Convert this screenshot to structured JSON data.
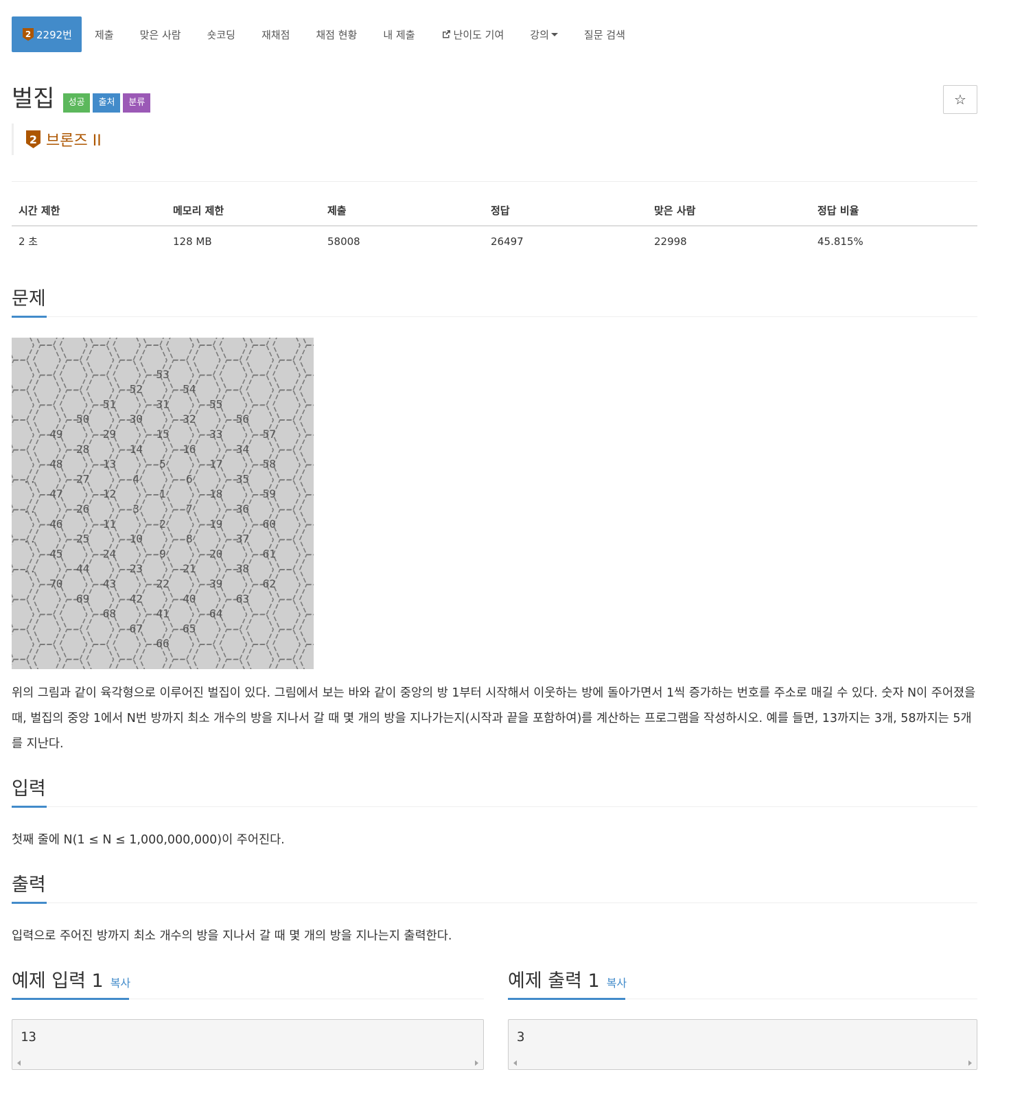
{
  "nav": {
    "items": [
      {
        "label": "2292번",
        "active": true,
        "tier_badge": "2"
      },
      {
        "label": "제출"
      },
      {
        "label": "맞은 사람"
      },
      {
        "label": "숏코딩"
      },
      {
        "label": "재채점"
      },
      {
        "label": "채점 현황"
      },
      {
        "label": "내 제출"
      },
      {
        "label": "난이도 기여",
        "icon": "external-link-icon"
      },
      {
        "label": "강의",
        "icon": "caret-down-icon"
      },
      {
        "label": "질문 검색"
      }
    ]
  },
  "problem": {
    "title": "벌집",
    "labels": [
      "성공",
      "출처",
      "분류"
    ],
    "tier_number": "2",
    "tier_label": "브론즈 II",
    "star_icon": "☆"
  },
  "stats": {
    "headers": [
      "시간 제한",
      "메모리 제한",
      "제출",
      "정답",
      "맞은 사람",
      "정답 비율"
    ],
    "values": [
      "2 초",
      "128 MB",
      "58008",
      "26497",
      "22998",
      "45.815%"
    ]
  },
  "sections": {
    "problem_title": "문제",
    "problem_text": "위의 그림과 같이 육각형으로 이루어진 벌집이 있다. 그림에서 보는 바와 같이 중앙의 방 1부터 시작해서 이웃하는 방에 돌아가면서 1씩 증가하는 번호를 주소로 매길 수 있다. 숫자 N이 주어졌을 때, 벌집의 중앙 1에서 N번 방까지 최소 개수의 방을 지나서 갈 때 몇 개의 방을 지나가는지(시작과 끝을 포함하여)를 계산하는 프로그램을 작성하시오. 예를 들면, 13까지는 3개, 58까지는 5개를 지난다.",
    "input_title": "입력",
    "input_text": "첫째 줄에 N(1 ≤ N ≤ 1,000,000,000)이 주어진다.",
    "output_title": "출력",
    "output_text": "입력으로 주어진 방까지 최소 개수의 방을 지나서 갈 때 몇 개의 방을 지나는지 출력한다."
  },
  "samples": {
    "input_title": "예제 입력 1",
    "output_title": "예제 출력 1",
    "copy_label": "복사",
    "input_value": "13",
    "output_value": "3"
  },
  "figure": {
    "cells": [
      {
        "n": "53",
        "c": 5,
        "r": 1
      },
      {
        "n": "52",
        "c": 4,
        "r": 2
      },
      {
        "n": "54",
        "c": 6,
        "r": 2
      },
      {
        "n": "51",
        "c": 3,
        "r": 3
      },
      {
        "n": "31",
        "c": 5,
        "r": 3
      },
      {
        "n": "55",
        "c": 7,
        "r": 3
      },
      {
        "n": "50",
        "c": 2,
        "r": 4
      },
      {
        "n": "30",
        "c": 4,
        "r": 4
      },
      {
        "n": "32",
        "c": 6,
        "r": 4
      },
      {
        "n": "56",
        "c": 8,
        "r": 4
      },
      {
        "n": "49",
        "c": 1,
        "r": 5
      },
      {
        "n": "29",
        "c": 3,
        "r": 5
      },
      {
        "n": "15",
        "c": 5,
        "r": 5
      },
      {
        "n": "33",
        "c": 7,
        "r": 5
      },
      {
        "n": "57",
        "c": 9,
        "r": 5
      },
      {
        "n": "28",
        "c": 2,
        "r": 6
      },
      {
        "n": "14",
        "c": 4,
        "r": 6
      },
      {
        "n": "16",
        "c": 6,
        "r": 6
      },
      {
        "n": "34",
        "c": 8,
        "r": 6
      },
      {
        "n": "48",
        "c": 1,
        "r": 7
      },
      {
        "n": "13",
        "c": 3,
        "r": 7
      },
      {
        "n": "5",
        "c": 5,
        "r": 7
      },
      {
        "n": "17",
        "c": 7,
        "r": 7
      },
      {
        "n": "58",
        "c": 9,
        "r": 7
      },
      {
        "n": "..",
        "c": 0,
        "r": 8
      },
      {
        "n": "27",
        "c": 2,
        "r": 8
      },
      {
        "n": "4",
        "c": 4,
        "r": 8
      },
      {
        "n": "6",
        "c": 6,
        "r": 8
      },
      {
        "n": "35",
        "c": 8,
        "r": 8
      },
      {
        "n": "47",
        "c": 1,
        "r": 9
      },
      {
        "n": "12",
        "c": 3,
        "r": 9
      },
      {
        "n": "1",
        "c": 5,
        "r": 9
      },
      {
        "n": "18",
        "c": 7,
        "r": 9
      },
      {
        "n": "59",
        "c": 9,
        "r": 9
      },
      {
        "n": "..",
        "c": 0,
        "r": 10
      },
      {
        "n": "26",
        "c": 2,
        "r": 10
      },
      {
        "n": "3",
        "c": 4,
        "r": 10
      },
      {
        "n": "7",
        "c": 6,
        "r": 10
      },
      {
        "n": "36",
        "c": 8,
        "r": 10
      },
      {
        "n": "46",
        "c": 1,
        "r": 11
      },
      {
        "n": "11",
        "c": 3,
        "r": 11
      },
      {
        "n": "2",
        "c": 5,
        "r": 11
      },
      {
        "n": "19",
        "c": 7,
        "r": 11
      },
      {
        "n": "60",
        "c": 9,
        "r": 11
      },
      {
        "n": "..",
        "c": 0,
        "r": 12
      },
      {
        "n": "25",
        "c": 2,
        "r": 12
      },
      {
        "n": "10",
        "c": 4,
        "r": 12
      },
      {
        "n": "8",
        "c": 6,
        "r": 12
      },
      {
        "n": "37",
        "c": 8,
        "r": 12
      },
      {
        "n": "45",
        "c": 1,
        "r": 13
      },
      {
        "n": "24",
        "c": 3,
        "r": 13
      },
      {
        "n": "9",
        "c": 5,
        "r": 13
      },
      {
        "n": "20",
        "c": 7,
        "r": 13
      },
      {
        "n": "61",
        "c": 9,
        "r": 13
      },
      {
        "n": "..",
        "c": 0,
        "r": 14
      },
      {
        "n": "44",
        "c": 2,
        "r": 14
      },
      {
        "n": "23",
        "c": 4,
        "r": 14
      },
      {
        "n": "21",
        "c": 6,
        "r": 14
      },
      {
        "n": "38",
        "c": 8,
        "r": 14
      },
      {
        "n": "70",
        "c": 1,
        "r": 15
      },
      {
        "n": "43",
        "c": 3,
        "r": 15
      },
      {
        "n": "22",
        "c": 5,
        "r": 15
      },
      {
        "n": "39",
        "c": 7,
        "r": 15
      },
      {
        "n": "62",
        "c": 9,
        "r": 15
      },
      {
        "n": "69",
        "c": 2,
        "r": 16
      },
      {
        "n": "42",
        "c": 4,
        "r": 16
      },
      {
        "n": "40",
        "c": 6,
        "r": 16
      },
      {
        "n": "63",
        "c": 8,
        "r": 16
      },
      {
        "n": "68",
        "c": 3,
        "r": 17
      },
      {
        "n": "41",
        "c": 5,
        "r": 17
      },
      {
        "n": "64",
        "c": 7,
        "r": 17
      },
      {
        "n": "67",
        "c": 4,
        "r": 18
      },
      {
        "n": "65",
        "c": 6,
        "r": 18
      },
      {
        "n": "66",
        "c": 5,
        "r": 19
      }
    ]
  }
}
